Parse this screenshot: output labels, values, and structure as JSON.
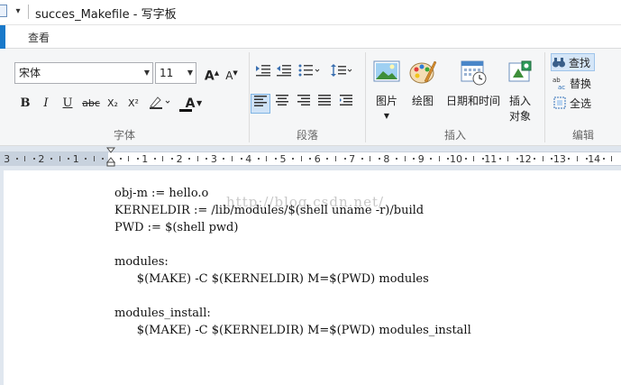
{
  "window": {
    "title": "succes_Makefile - 写字板"
  },
  "tabs": {
    "view": "查看"
  },
  "font_group": {
    "label": "字体",
    "font_name": "宋体",
    "font_size": "11",
    "grow_font": "A",
    "shrink_font": "A",
    "bold": "B",
    "italic": "I",
    "underline": "U",
    "strikethrough": "abc",
    "subscript": "X₂",
    "superscript": "X²",
    "text_color": "A"
  },
  "paragraph_group": {
    "label": "段落"
  },
  "insert_group": {
    "label": "插入",
    "picture": "图片",
    "paint": "绘图",
    "datetime": "日期和时间",
    "insert_object_line1": "插入",
    "insert_object_line2": "对象"
  },
  "edit_group": {
    "label": "编辑",
    "find": "查找",
    "replace": "替换",
    "select_all": "全选"
  },
  "ruler": {
    "left_labels": [
      "3",
      "2",
      "1"
    ],
    "right_labels": [
      "1",
      "2",
      "3",
      "4",
      "5",
      "6",
      "7",
      "8",
      "9",
      "10",
      "11",
      "12",
      "13",
      "14"
    ]
  },
  "document": {
    "lines": [
      "obj-m := hello.o",
      "KERNELDIR := /lib/modules/$(shell uname -r)/build",
      "PWD := $(shell pwd)",
      "",
      "modules:",
      "      $(MAKE) -C $(KERNELDIR) M=$(PWD) modules",
      "",
      "modules_install:",
      "      $(MAKE) -C $(KERNELDIR) M=$(PWD) modules_install"
    ],
    "watermark": "http://blog.csdn.net/"
  }
}
